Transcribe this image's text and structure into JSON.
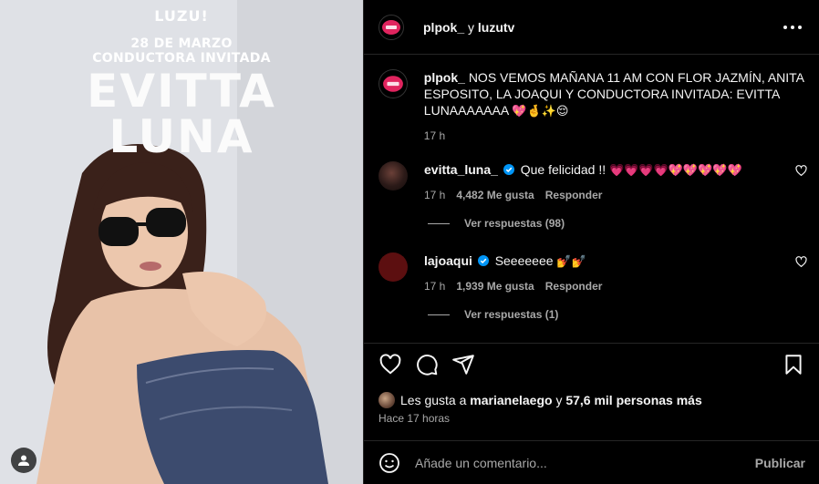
{
  "poster": {
    "brand": "LUZU!",
    "date": "28 DE MARZO",
    "role": "CONDUCTORA INVITADA",
    "name_line1": "EVITTA",
    "name_line2": "LUNA"
  },
  "header": {
    "account1": "plpok_",
    "connector": "y",
    "account2": "luzutv"
  },
  "caption": {
    "user": "plpok_",
    "text": "NOS VEMOS MAÑANA 11 AM CON FLOR JAZMÍN, ANITA ESPOSITO, LA JOAQUI Y CONDUCTORA INVITADA: EVITTA LUNAAAAAAA",
    "emojis": "💖🤞✨😌",
    "time": "17 h"
  },
  "comments": [
    {
      "user": "evitta_luna_",
      "text": "Que felicidad !!",
      "emojis": "💗💗💗💗💖💖💖💖💖",
      "time": "17 h",
      "likes": "4,482 Me gusta",
      "reply": "Responder",
      "view_replies": "Ver respuestas (98)"
    },
    {
      "user": "lajoaqui",
      "text": "Seeeeeee",
      "emojis": "💅💅",
      "time": "17 h",
      "likes": "1,939 Me gusta",
      "reply": "Responder",
      "view_replies": "Ver respuestas (1)"
    }
  ],
  "likes": {
    "prefix": "Les gusta a",
    "user": "marianelaego",
    "connector": "y",
    "others": "57,6 mil personas más"
  },
  "timestamp": "Hace 17 horas",
  "add_comment": {
    "placeholder": "Añade un comentario...",
    "publish": "Publicar"
  },
  "colors": {
    "accent_verified": "#0095f6",
    "like_red": "#ed4956",
    "muted": "#a8a8a8"
  }
}
